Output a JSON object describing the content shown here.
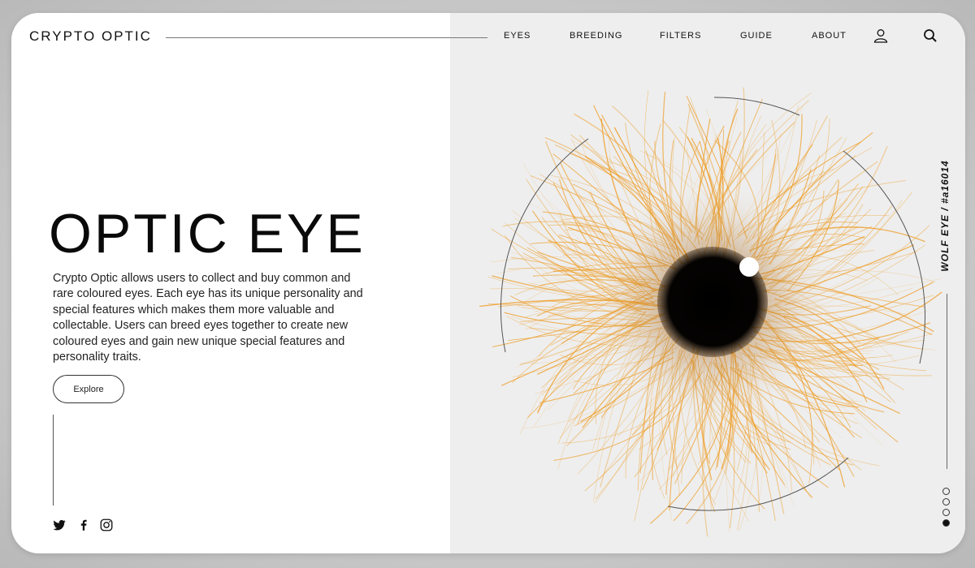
{
  "brand": {
    "name": "CRYPTO OPTIC"
  },
  "nav": {
    "items": [
      {
        "label": "EYES"
      },
      {
        "label": "BREEDING"
      },
      {
        "label": "FILTERS"
      },
      {
        "label": "GUIDE"
      },
      {
        "label": "ABOUT"
      }
    ],
    "user_icon": "user-icon",
    "search_icon": "search-icon"
  },
  "hero": {
    "title": "OPTIC EYE",
    "description": "Crypto Optic allows users to collect and buy common and rare coloured eyes. Each eye has its unique personality and special features which makes them more valuable and collectable. Users can breed eyes together to create new coloured eyes and gain new unique special features and personality traits.",
    "cta_label": "Explore"
  },
  "social": [
    {
      "icon": "twitter-icon"
    },
    {
      "icon": "facebook-icon"
    },
    {
      "icon": "instagram-icon"
    }
  ],
  "eye": {
    "label": "WOLF EYE / #a16014",
    "iris_color": "#ee9a1e",
    "pupil_color": "#000000"
  },
  "pager": {
    "total": 4,
    "active": 4
  },
  "colors": {
    "accent": "#ee9a1e",
    "text": "#111111",
    "panel_right": "#eeeeee"
  }
}
